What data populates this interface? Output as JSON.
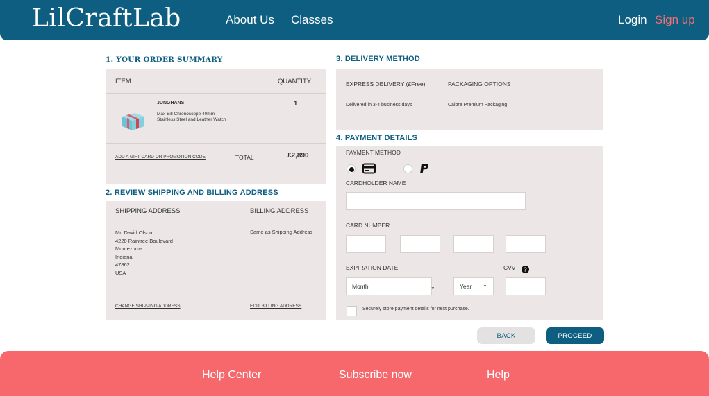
{
  "header": {
    "logo": "LilCraftLab",
    "nav": {
      "about": "About Us",
      "classes": "Classes"
    },
    "login": "Login",
    "signup": "Sign up"
  },
  "order": {
    "title": "1. YOUR ORDER SUMMARY",
    "col_item": "ITEM",
    "col_quantity": "QUANTITY",
    "brand": "JUNGHANS",
    "description": "Max Bill Chronoscope 40mm Stainless Steel and Leather Watch",
    "quantity": "1",
    "gift_link": "ADD A GIFT CARD OR PROMOTION CODE",
    "total_label": "TOTAL",
    "total_value": "£2,890"
  },
  "address": {
    "title": "2. REVIEW SHIPPING AND BILLING ADDRESS",
    "shipping_label": "SHIPPING ADDRESS",
    "billing_label": "BILLING ADDRESS",
    "shipping_lines": [
      "Mr. David Olson",
      "4220 Raintree Boulevard",
      "Montezuma",
      "Indiana",
      "47862",
      "USA"
    ],
    "billing_text": "Same as Shipping Address",
    "change_shipping": "CHANGE SHIPPING ADDRESS",
    "edit_billing": "EDIT BILLING ADDRESS"
  },
  "delivery": {
    "title": "3. DELIVERY METHOD",
    "method_label": "EXPRESS DELIVERY (£Free)",
    "method_detail": "Delivered in 3-4 business days",
    "packaging_label": "PACKAGING OPTIONS",
    "packaging_detail": "Caibre Premium Packaging"
  },
  "payment": {
    "title": "4. PAYMENT DETAILS",
    "method_label": "PAYMENT METHOD",
    "selected_method": "card",
    "cardholder_label": "CARDHOLDER NAME",
    "card_number_label": "CARD NUMBER",
    "expiration_label": "EXPIRATION DATE",
    "month": "Month",
    "year": "Year",
    "cvv_label": "CVV",
    "store_label": "Securely store payment details for next purchase."
  },
  "buttons": {
    "back": "BACK",
    "proceed": "PROCEED"
  },
  "footer": {
    "help_center": "Help Center",
    "subscribe": "Subscribe now",
    "help": "Help"
  },
  "colors": {
    "brand": "#0d5e80",
    "accent": "#f6686b",
    "panel": "#ece7e6"
  },
  "icons": [
    "credit-card-icon",
    "paypal-icon",
    "help-circle-icon",
    "chevron-down-icon",
    "gift-box-icon"
  ]
}
